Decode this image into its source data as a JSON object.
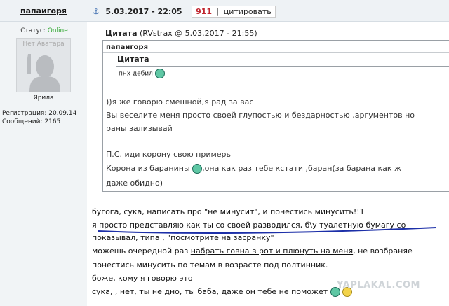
{
  "left": {
    "username": "папаигоря",
    "status_label": "Статус:",
    "status_value": "Online",
    "avatar_text": "Нет Аватара",
    "rank": "Ярила",
    "registration": "Регистрация: 20.09.14",
    "messages": "Сообщений: 2165"
  },
  "post": {
    "date": "5.03.2017 - 22:05",
    "rating": "911",
    "quote_link": "цитировать"
  },
  "quote": {
    "title": "Цитата",
    "attribution": "(RVstrax @ 5.03.2017 - 21:55)",
    "user": "папаигоря",
    "inner_title": "Цитата",
    "inner_text": "пнх дебил",
    "lines": [
      "))я же говорю смешной,я рад за вас",
      "Вы веселите меня просто своей глупостью и бездарностью ,аргументов но",
      "раны зализывай",
      "П.С. иди корону свою примерь",
      "Корона из баранины",
      ",она как раз тебе кстати ,баран(за барана как ж",
      "даже обидно)"
    ]
  },
  "body": {
    "l1": "бугога, сука, написать про \"не минусит\", и понестись минусить!!1",
    "l2": "я просто представляю как ты со своей разводился, б\\у туалетную бумагу со",
    "l3": "показывал, типа , \"посмотрите на засранку\"",
    "l4a": "можешь очередной раз ",
    "l4b": "набрать говна в рот и плюнуть на меня",
    "l4c": ", не возбраняе",
    "l5": "понестись минусить по темам в возрасте под полтинник.",
    "l6": "боже, кому я говорю это",
    "l7": "сука, , нет, ты не дно, ты баба, даже он тебе не поможет"
  },
  "watermark": "YAPLAKAL.COM",
  "colors": {
    "online": "#2aa52a",
    "rating": "#c0262f",
    "underline_pen": "#1c2fa8",
    "sidebar": "#f1f4f6"
  }
}
